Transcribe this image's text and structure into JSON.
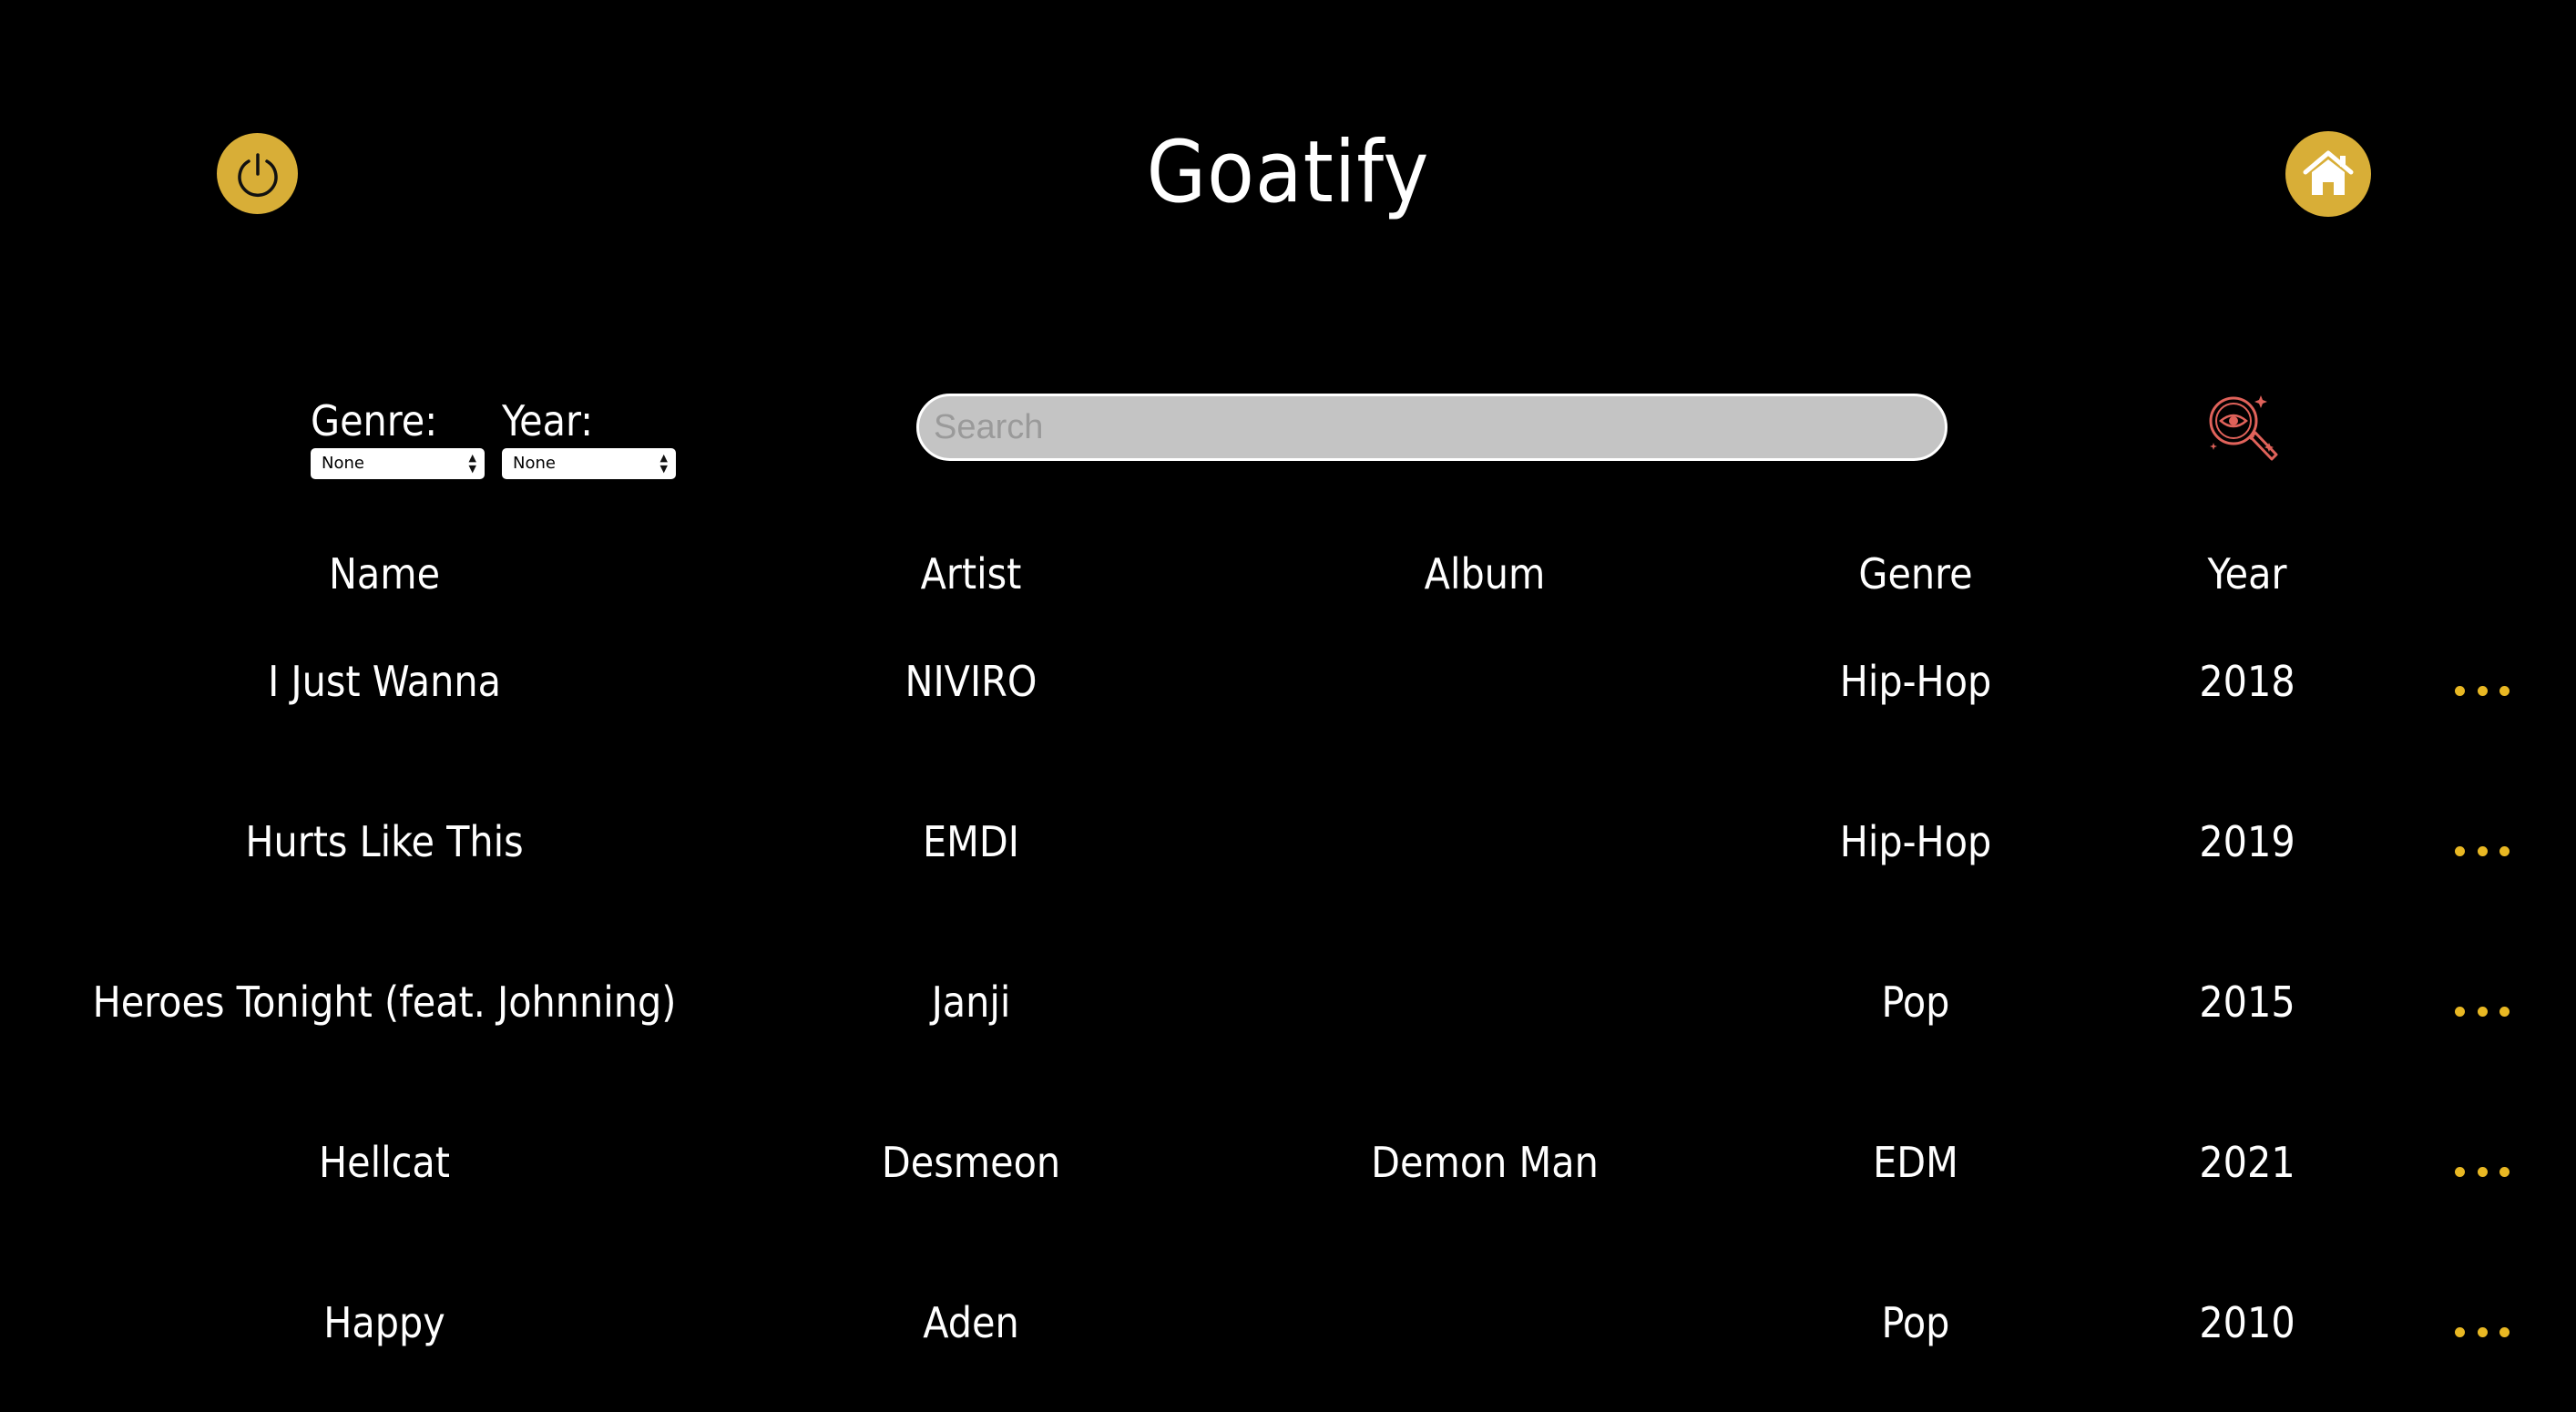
{
  "header": {
    "title": "Goatify",
    "power_icon": "power-icon",
    "home_icon": "home-icon"
  },
  "filters": {
    "genre_label": "Genre:",
    "genre_value": "None",
    "year_label": "Year:",
    "year_value": "None"
  },
  "search": {
    "placeholder": "Search",
    "icon": "search-eye-icon"
  },
  "table": {
    "columns": [
      "Name",
      "Artist",
      "Album",
      "Genre",
      "Year"
    ],
    "rows": [
      {
        "name": "I Just Wanna",
        "artist": "NIVIRO",
        "album": "",
        "genre": "Hip-Hop",
        "year": "2018"
      },
      {
        "name": "Hurts Like This",
        "artist": "EMDI",
        "album": "",
        "genre": "Hip-Hop",
        "year": "2019"
      },
      {
        "name": "Heroes Tonight (feat. Johnning)",
        "artist": "Janji",
        "album": "",
        "genre": "Pop",
        "year": "2015"
      },
      {
        "name": "Hellcat",
        "artist": "Desmeon",
        "album": "Demon Man",
        "genre": "EDM",
        "year": "2021"
      },
      {
        "name": "Happy",
        "artist": "Aden",
        "album": "",
        "genre": "Pop",
        "year": "2010"
      }
    ],
    "row_action_icon": "more-options-icon"
  },
  "colors": {
    "background": "#000000",
    "accent_gold": "#d8ae37",
    "dots_yellow": "#e9b823",
    "search_fill": "#c4c4c4",
    "search_icon": "#e0625a"
  }
}
